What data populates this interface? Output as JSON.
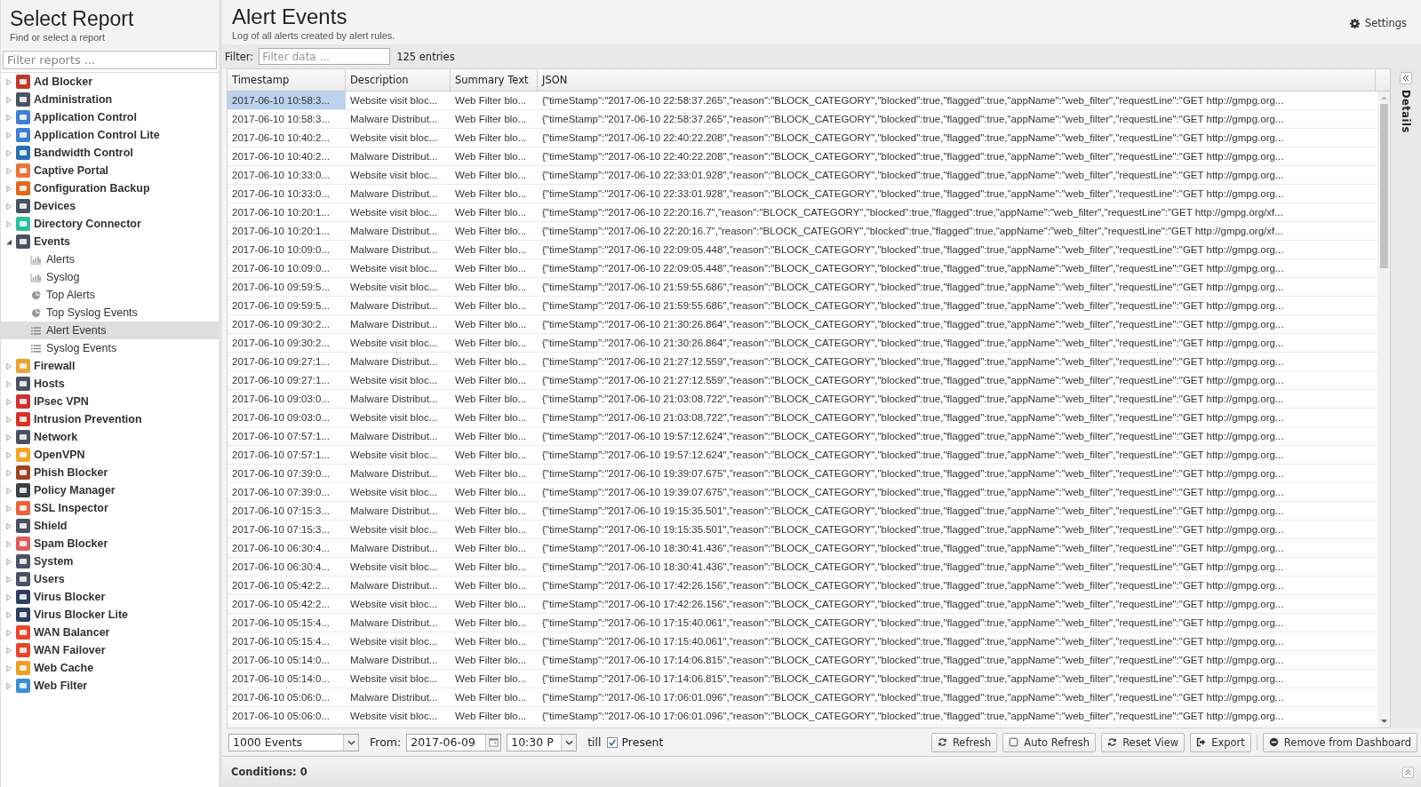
{
  "sidebar": {
    "title": "Select Report",
    "subtitle": "Find or select a report",
    "search": {
      "placeholder": "Filter reports ..."
    },
    "items": [
      {
        "label": "Ad Blocker",
        "color": "#c0392b",
        "expanded": false,
        "selected": false
      },
      {
        "label": "Administration",
        "color": "#4a5162",
        "expanded": false,
        "selected": false
      },
      {
        "label": "Application Control",
        "color": "#3b7fd6",
        "expanded": false,
        "selected": false
      },
      {
        "label": "Application Control Lite",
        "color": "#3b7fd6",
        "expanded": false,
        "selected": false
      },
      {
        "label": "Bandwidth Control",
        "color": "#2a6fb0",
        "expanded": false,
        "selected": false
      },
      {
        "label": "Captive Portal",
        "color": "#e8743b",
        "expanded": false,
        "selected": false
      },
      {
        "label": "Configuration Backup",
        "color": "#e06a1a",
        "expanded": false,
        "selected": false
      },
      {
        "label": "Devices",
        "color": "#4a5162",
        "expanded": false,
        "selected": false
      },
      {
        "label": "Directory Connector",
        "color": "#2cc0a0",
        "expanded": false,
        "selected": false
      },
      {
        "label": "Events",
        "color": "#4a5162",
        "expanded": true,
        "selected": false,
        "children": [
          {
            "label": "Alerts",
            "kind": "bars",
            "selected": false
          },
          {
            "label": "Syslog",
            "kind": "bars",
            "selected": false
          },
          {
            "label": "Top Alerts",
            "kind": "pie",
            "selected": false
          },
          {
            "label": "Top Syslog Events",
            "kind": "pie",
            "selected": false
          },
          {
            "label": "Alert Events",
            "kind": "list",
            "selected": true
          },
          {
            "label": "Syslog Events",
            "kind": "list",
            "selected": false
          }
        ]
      },
      {
        "label": "Firewall",
        "color": "#f0a030",
        "expanded": false,
        "selected": false
      },
      {
        "label": "Hosts",
        "color": "#4a5162",
        "expanded": false,
        "selected": false
      },
      {
        "label": "IPsec VPN",
        "color": "#d32f2f",
        "expanded": false,
        "selected": false
      },
      {
        "label": "Intrusion Prevention",
        "color": "#d93025",
        "expanded": false,
        "selected": false
      },
      {
        "label": "Network",
        "color": "#4a5162",
        "expanded": false,
        "selected": false
      },
      {
        "label": "OpenVPN",
        "color": "#f5a623",
        "expanded": false,
        "selected": false
      },
      {
        "label": "Phish Blocker",
        "color": "#a0421c",
        "expanded": false,
        "selected": false
      },
      {
        "label": "Policy Manager",
        "color": "#3a3f4a",
        "expanded": false,
        "selected": false
      },
      {
        "label": "SSL Inspector",
        "color": "#f0603a",
        "expanded": false,
        "selected": false
      },
      {
        "label": "Shield",
        "color": "#4a5162",
        "expanded": false,
        "selected": false
      },
      {
        "label": "Spam Blocker",
        "color": "#e05a5a",
        "expanded": false,
        "selected": false
      },
      {
        "label": "System",
        "color": "#4a5162",
        "expanded": false,
        "selected": false
      },
      {
        "label": "Users",
        "color": "#4a5162",
        "expanded": false,
        "selected": false
      },
      {
        "label": "Virus Blocker",
        "color": "#2c3e60",
        "expanded": false,
        "selected": false
      },
      {
        "label": "Virus Blocker Lite",
        "color": "#2c3e60",
        "expanded": false,
        "selected": false
      },
      {
        "label": "WAN Balancer",
        "color": "#e8452c",
        "expanded": false,
        "selected": false
      },
      {
        "label": "WAN Failover",
        "color": "#e8452c",
        "expanded": false,
        "selected": false
      },
      {
        "label": "Web Cache",
        "color": "#f0a020",
        "expanded": false,
        "selected": false
      },
      {
        "label": "Web Filter",
        "color": "#3a8fd8",
        "expanded": false,
        "selected": false
      }
    ]
  },
  "header": {
    "title": "Alert Events",
    "subtitle": "Log of all alerts created by alert rules.",
    "settings": "Settings"
  },
  "filter": {
    "label": "Filter:",
    "placeholder": "Filter data ...",
    "count": "125 entries"
  },
  "table": {
    "columns": [
      "Timestamp",
      "Description",
      "Summary Text",
      "JSON"
    ],
    "rows": [
      {
        "selected": true,
        "cells": [
          "2017-06-10 10:58:3...",
          "Website visit bloc...",
          "Web Filter blo...",
          "{\"timeStamp\":\"2017-06-10 22:58:37.265\",\"reason\":\"BLOCK_CATEGORY\",\"blocked\":true,\"flagged\":true,\"appName\":\"web_filter\",\"requestLine\":\"GET http://gmpg.org..."
        ]
      },
      {
        "selected": false,
        "cells": [
          "2017-06-10 10:58:3...",
          "Malware Distribut...",
          "Web Filter blo...",
          "{\"timeStamp\":\"2017-06-10 22:58:37.265\",\"reason\":\"BLOCK_CATEGORY\",\"blocked\":true,\"flagged\":true,\"appName\":\"web_filter\",\"requestLine\":\"GET http://gmpg.org..."
        ]
      },
      {
        "selected": false,
        "cells": [
          "2017-06-10 10:40:2...",
          "Website visit bloc...",
          "Web Filter blo...",
          "{\"timeStamp\":\"2017-06-10 22:40:22.208\",\"reason\":\"BLOCK_CATEGORY\",\"blocked\":true,\"flagged\":true,\"appName\":\"web_filter\",\"requestLine\":\"GET http://gmpg.org..."
        ]
      },
      {
        "selected": false,
        "cells": [
          "2017-06-10 10:40:2...",
          "Malware Distribut...",
          "Web Filter blo...",
          "{\"timeStamp\":\"2017-06-10 22:40:22.208\",\"reason\":\"BLOCK_CATEGORY\",\"blocked\":true,\"flagged\":true,\"appName\":\"web_filter\",\"requestLine\":\"GET http://gmpg.org..."
        ]
      },
      {
        "selected": false,
        "cells": [
          "2017-06-10 10:33:0...",
          "Website visit bloc...",
          "Web Filter blo...",
          "{\"timeStamp\":\"2017-06-10 22:33:01.928\",\"reason\":\"BLOCK_CATEGORY\",\"blocked\":true,\"flagged\":true,\"appName\":\"web_filter\",\"requestLine\":\"GET http://gmpg.org..."
        ]
      },
      {
        "selected": false,
        "cells": [
          "2017-06-10 10:33:0...",
          "Malware Distribut...",
          "Web Filter blo...",
          "{\"timeStamp\":\"2017-06-10 22:33:01.928\",\"reason\":\"BLOCK_CATEGORY\",\"blocked\":true,\"flagged\":true,\"appName\":\"web_filter\",\"requestLine\":\"GET http://gmpg.org..."
        ]
      },
      {
        "selected": false,
        "cells": [
          "2017-06-10 10:20:1...",
          "Website visit bloc...",
          "Web Filter blo...",
          "{\"timeStamp\":\"2017-06-10 22:20:16.7\",\"reason\":\"BLOCK_CATEGORY\",\"blocked\":true,\"flagged\":true,\"appName\":\"web_filter\",\"requestLine\":\"GET http://gmpg.org/xf..."
        ]
      },
      {
        "selected": false,
        "cells": [
          "2017-06-10 10:20:1...",
          "Malware Distribut...",
          "Web Filter blo...",
          "{\"timeStamp\":\"2017-06-10 22:20:16.7\",\"reason\":\"BLOCK_CATEGORY\",\"blocked\":true,\"flagged\":true,\"appName\":\"web_filter\",\"requestLine\":\"GET http://gmpg.org/xf..."
        ]
      },
      {
        "selected": false,
        "cells": [
          "2017-06-10 10:09:0...",
          "Malware Distribut...",
          "Web Filter blo...",
          "{\"timeStamp\":\"2017-06-10 22:09:05.448\",\"reason\":\"BLOCK_CATEGORY\",\"blocked\":true,\"flagged\":true,\"appName\":\"web_filter\",\"requestLine\":\"GET http://gmpg.org..."
        ]
      },
      {
        "selected": false,
        "cells": [
          "2017-06-10 10:09:0...",
          "Website visit bloc...",
          "Web Filter blo...",
          "{\"timeStamp\":\"2017-06-10 22:09:05.448\",\"reason\":\"BLOCK_CATEGORY\",\"blocked\":true,\"flagged\":true,\"appName\":\"web_filter\",\"requestLine\":\"GET http://gmpg.org..."
        ]
      },
      {
        "selected": false,
        "cells": [
          "2017-06-10 09:59:5...",
          "Website visit bloc...",
          "Web Filter blo...",
          "{\"timeStamp\":\"2017-06-10 21:59:55.686\",\"reason\":\"BLOCK_CATEGORY\",\"blocked\":true,\"flagged\":true,\"appName\":\"web_filter\",\"requestLine\":\"GET http://gmpg.org..."
        ]
      },
      {
        "selected": false,
        "cells": [
          "2017-06-10 09:59:5...",
          "Malware Distribut...",
          "Web Filter blo...",
          "{\"timeStamp\":\"2017-06-10 21:59:55.686\",\"reason\":\"BLOCK_CATEGORY\",\"blocked\":true,\"flagged\":true,\"appName\":\"web_filter\",\"requestLine\":\"GET http://gmpg.org..."
        ]
      },
      {
        "selected": false,
        "cells": [
          "2017-06-10 09:30:2...",
          "Malware Distribut...",
          "Web Filter blo...",
          "{\"timeStamp\":\"2017-06-10 21:30:26.864\",\"reason\":\"BLOCK_CATEGORY\",\"blocked\":true,\"flagged\":true,\"appName\":\"web_filter\",\"requestLine\":\"GET http://gmpg.org..."
        ]
      },
      {
        "selected": false,
        "cells": [
          "2017-06-10 09:30:2...",
          "Website visit bloc...",
          "Web Filter blo...",
          "{\"timeStamp\":\"2017-06-10 21:30:26.864\",\"reason\":\"BLOCK_CATEGORY\",\"blocked\":true,\"flagged\":true,\"appName\":\"web_filter\",\"requestLine\":\"GET http://gmpg.org..."
        ]
      },
      {
        "selected": false,
        "cells": [
          "2017-06-10 09:27:1...",
          "Malware Distribut...",
          "Web Filter blo...",
          "{\"timeStamp\":\"2017-06-10 21:27:12.559\",\"reason\":\"BLOCK_CATEGORY\",\"blocked\":true,\"flagged\":true,\"appName\":\"web_filter\",\"requestLine\":\"GET http://gmpg.org..."
        ]
      },
      {
        "selected": false,
        "cells": [
          "2017-06-10 09:27:1...",
          "Website visit bloc...",
          "Web Filter blo...",
          "{\"timeStamp\":\"2017-06-10 21:27:12.559\",\"reason\":\"BLOCK_CATEGORY\",\"blocked\":true,\"flagged\":true,\"appName\":\"web_filter\",\"requestLine\":\"GET http://gmpg.org..."
        ]
      },
      {
        "selected": false,
        "cells": [
          "2017-06-10 09:03:0...",
          "Malware Distribut...",
          "Web Filter blo...",
          "{\"timeStamp\":\"2017-06-10 21:03:08.722\",\"reason\":\"BLOCK_CATEGORY\",\"blocked\":true,\"flagged\":true,\"appName\":\"web_filter\",\"requestLine\":\"GET http://gmpg.org..."
        ]
      },
      {
        "selected": false,
        "cells": [
          "2017-06-10 09:03:0...",
          "Website visit bloc...",
          "Web Filter blo...",
          "{\"timeStamp\":\"2017-06-10 21:03:08.722\",\"reason\":\"BLOCK_CATEGORY\",\"blocked\":true,\"flagged\":true,\"appName\":\"web_filter\",\"requestLine\":\"GET http://gmpg.org..."
        ]
      },
      {
        "selected": false,
        "cells": [
          "2017-06-10 07:57:1...",
          "Malware Distribut...",
          "Web Filter blo...",
          "{\"timeStamp\":\"2017-06-10 19:57:12.624\",\"reason\":\"BLOCK_CATEGORY\",\"blocked\":true,\"flagged\":true,\"appName\":\"web_filter\",\"requestLine\":\"GET http://gmpg.org..."
        ]
      },
      {
        "selected": false,
        "cells": [
          "2017-06-10 07:57:1...",
          "Website visit bloc...",
          "Web Filter blo...",
          "{\"timeStamp\":\"2017-06-10 19:57:12.624\",\"reason\":\"BLOCK_CATEGORY\",\"blocked\":true,\"flagged\":true,\"appName\":\"web_filter\",\"requestLine\":\"GET http://gmpg.org..."
        ]
      },
      {
        "selected": false,
        "cells": [
          "2017-06-10 07:39:0...",
          "Malware Distribut...",
          "Web Filter blo...",
          "{\"timeStamp\":\"2017-06-10 19:39:07.675\",\"reason\":\"BLOCK_CATEGORY\",\"blocked\":true,\"flagged\":true,\"appName\":\"web_filter\",\"requestLine\":\"GET http://gmpg.org..."
        ]
      },
      {
        "selected": false,
        "cells": [
          "2017-06-10 07:39:0...",
          "Website visit bloc...",
          "Web Filter blo...",
          "{\"timeStamp\":\"2017-06-10 19:39:07.675\",\"reason\":\"BLOCK_CATEGORY\",\"blocked\":true,\"flagged\":true,\"appName\":\"web_filter\",\"requestLine\":\"GET http://gmpg.org..."
        ]
      },
      {
        "selected": false,
        "cells": [
          "2017-06-10 07:15:3...",
          "Malware Distribut...",
          "Web Filter blo...",
          "{\"timeStamp\":\"2017-06-10 19:15:35.501\",\"reason\":\"BLOCK_CATEGORY\",\"blocked\":true,\"flagged\":true,\"appName\":\"web_filter\",\"requestLine\":\"GET http://gmpg.org..."
        ]
      },
      {
        "selected": false,
        "cells": [
          "2017-06-10 07:15:3...",
          "Website visit bloc...",
          "Web Filter blo...",
          "{\"timeStamp\":\"2017-06-10 19:15:35.501\",\"reason\":\"BLOCK_CATEGORY\",\"blocked\":true,\"flagged\":true,\"appName\":\"web_filter\",\"requestLine\":\"GET http://gmpg.org..."
        ]
      },
      {
        "selected": false,
        "cells": [
          "2017-06-10 06:30:4...",
          "Malware Distribut...",
          "Web Filter blo...",
          "{\"timeStamp\":\"2017-06-10 18:30:41.436\",\"reason\":\"BLOCK_CATEGORY\",\"blocked\":true,\"flagged\":true,\"appName\":\"web_filter\",\"requestLine\":\"GET http://gmpg.org..."
        ]
      },
      {
        "selected": false,
        "cells": [
          "2017-06-10 06:30:4...",
          "Website visit bloc...",
          "Web Filter blo...",
          "{\"timeStamp\":\"2017-06-10 18:30:41.436\",\"reason\":\"BLOCK_CATEGORY\",\"blocked\":true,\"flagged\":true,\"appName\":\"web_filter\",\"requestLine\":\"GET http://gmpg.org..."
        ]
      },
      {
        "selected": false,
        "cells": [
          "2017-06-10 05:42:2...",
          "Malware Distribut...",
          "Web Filter blo...",
          "{\"timeStamp\":\"2017-06-10 17:42:26.156\",\"reason\":\"BLOCK_CATEGORY\",\"blocked\":true,\"flagged\":true,\"appName\":\"web_filter\",\"requestLine\":\"GET http://gmpg.org..."
        ]
      },
      {
        "selected": false,
        "cells": [
          "2017-06-10 05:42:2...",
          "Website visit bloc...",
          "Web Filter blo...",
          "{\"timeStamp\":\"2017-06-10 17:42:26.156\",\"reason\":\"BLOCK_CATEGORY\",\"blocked\":true,\"flagged\":true,\"appName\":\"web_filter\",\"requestLine\":\"GET http://gmpg.org..."
        ]
      },
      {
        "selected": false,
        "cells": [
          "2017-06-10 05:15:4...",
          "Malware Distribut...",
          "Web Filter blo...",
          "{\"timeStamp\":\"2017-06-10 17:15:40.061\",\"reason\":\"BLOCK_CATEGORY\",\"blocked\":true,\"flagged\":true,\"appName\":\"web_filter\",\"requestLine\":\"GET http://gmpg.org..."
        ]
      },
      {
        "selected": false,
        "cells": [
          "2017-06-10 05:15:4...",
          "Website visit bloc...",
          "Web Filter blo...",
          "{\"timeStamp\":\"2017-06-10 17:15:40.061\",\"reason\":\"BLOCK_CATEGORY\",\"blocked\":true,\"flagged\":true,\"appName\":\"web_filter\",\"requestLine\":\"GET http://gmpg.org..."
        ]
      },
      {
        "selected": false,
        "cells": [
          "2017-06-10 05:14:0...",
          "Malware Distribut...",
          "Web Filter blo...",
          "{\"timeStamp\":\"2017-06-10 17:14:06.815\",\"reason\":\"BLOCK_CATEGORY\",\"blocked\":true,\"flagged\":true,\"appName\":\"web_filter\",\"requestLine\":\"GET http://gmpg.org..."
        ]
      },
      {
        "selected": false,
        "cells": [
          "2017-06-10 05:14:0...",
          "Website visit bloc...",
          "Web Filter blo...",
          "{\"timeStamp\":\"2017-06-10 17:14:06.815\",\"reason\":\"BLOCK_CATEGORY\",\"blocked\":true,\"flagged\":true,\"appName\":\"web_filter\",\"requestLine\":\"GET http://gmpg.org..."
        ]
      },
      {
        "selected": false,
        "cells": [
          "2017-06-10 05:06:0...",
          "Malware Distribut...",
          "Web Filter blo...",
          "{\"timeStamp\":\"2017-06-10 17:06:01.096\",\"reason\":\"BLOCK_CATEGORY\",\"blocked\":true,\"flagged\":true,\"appName\":\"web_filter\",\"requestLine\":\"GET http://gmpg.org..."
        ]
      },
      {
        "selected": false,
        "cells": [
          "2017-06-10 05:06:0...",
          "Website visit bloc...",
          "Web Filter blo...",
          "{\"timeStamp\":\"2017-06-10 17:06:01.096\",\"reason\":\"BLOCK_CATEGORY\",\"blocked\":true,\"flagged\":true,\"appName\":\"web_filter\",\"requestLine\":\"GET http://gmpg.org..."
        ]
      }
    ]
  },
  "toolbar": {
    "limit": "1000 Events",
    "from_label": "From:",
    "date": "2017-06-09",
    "time": "10:30 P",
    "till_label": "till",
    "present": {
      "label": "Present",
      "checked": true
    },
    "buttons": [
      {
        "label": "Refresh",
        "kind": "refresh"
      },
      {
        "label": "Auto Refresh",
        "kind": "toggle",
        "checked": false
      },
      {
        "label": "Reset View",
        "kind": "refresh"
      },
      {
        "label": "Export",
        "kind": "export"
      },
      {
        "label": "Remove from Dashboard",
        "kind": "remove"
      }
    ]
  },
  "conditions": "Conditions: 0",
  "details_tab": "Details"
}
